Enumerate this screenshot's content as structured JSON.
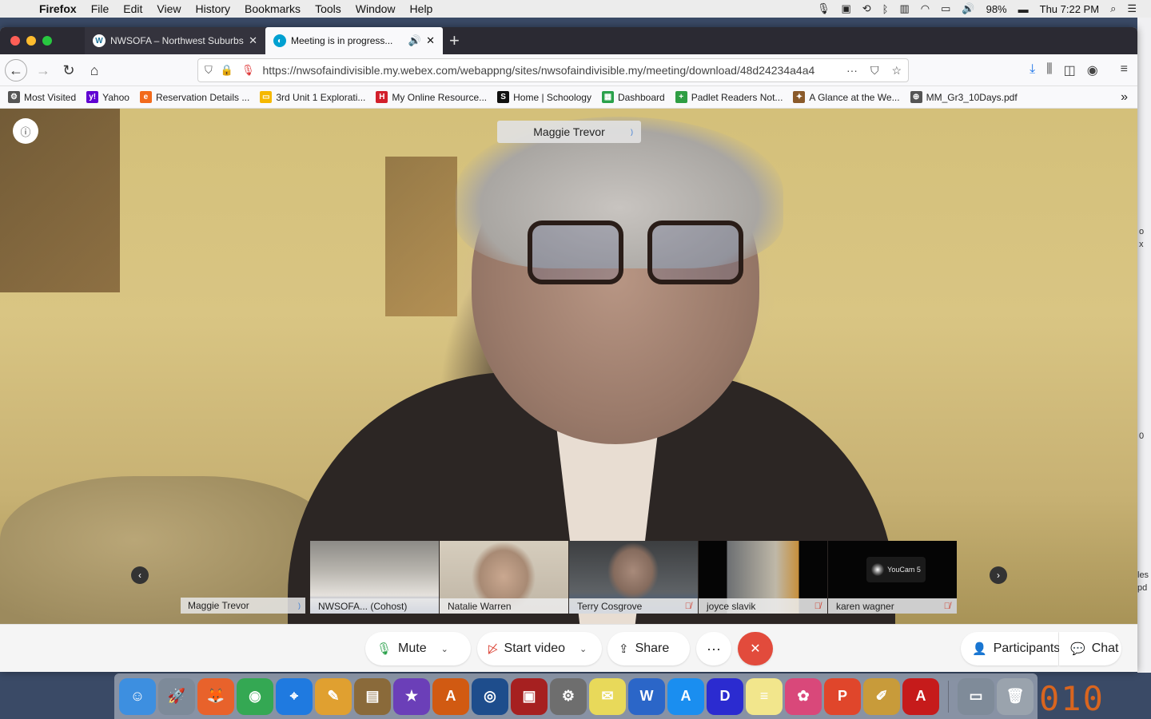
{
  "menubar": {
    "app": "Firefox",
    "items": [
      "File",
      "Edit",
      "View",
      "History",
      "Bookmarks",
      "Tools",
      "Window",
      "Help"
    ],
    "battery": "98%",
    "clock": "Thu 7:22 PM"
  },
  "tabs": [
    {
      "label": "NWSOFA – Northwest Suburbs",
      "icon": "wordpress-icon"
    },
    {
      "label": "Meeting is in progress...",
      "icon": "webex-icon"
    }
  ],
  "address_bar": {
    "url": "https://nwsofaindivisible.my.webex.com/webappng/sites/nwsofaindivisible.my/meeting/download/48d24234a4a4"
  },
  "bookmarks": [
    {
      "label": "Most Visited",
      "color": "#555555",
      "glyph": "⚙"
    },
    {
      "label": "Yahoo",
      "color": "#6001d2",
      "glyph": "y!"
    },
    {
      "label": "Reservation Details ...",
      "color": "#f26a1b",
      "glyph": "e"
    },
    {
      "label": "3rd Unit 1 Explorati...",
      "color": "#f5b800",
      "glyph": "▭"
    },
    {
      "label": "My Online Resource...",
      "color": "#d21f2b",
      "glyph": "H"
    },
    {
      "label": "Home | Schoology",
      "color": "#111111",
      "glyph": "S"
    },
    {
      "label": "Dashboard",
      "color": "#2aa14b",
      "glyph": "▦"
    },
    {
      "label": "Padlet Readers Not...",
      "color": "#2f9e44",
      "glyph": "+"
    },
    {
      "label": "A Glance at the We...",
      "color": "#8a5a2a",
      "glyph": "✦"
    },
    {
      "label": "MM_Gr3_10Days.pdf",
      "color": "#555555",
      "glyph": "⊕"
    }
  ],
  "meeting": {
    "active_speaker": "Maggie Trevor",
    "self_label": "Maggie Trevor",
    "thumbnails": [
      {
        "name": "NWSOFA... (Cohost)",
        "muted": false
      },
      {
        "name": "Natalie Warren",
        "muted": false
      },
      {
        "name": "Terry Cosgrove",
        "muted": true
      },
      {
        "name": "joyce slavik",
        "muted": true
      },
      {
        "name": "karen wagner",
        "muted": true,
        "camera_app": "YouCam 5"
      }
    ]
  },
  "controls": {
    "mute": "Mute",
    "start_video": "Start video",
    "share": "Share",
    "more": "···",
    "end": "✕",
    "participants": "Participants",
    "chat": "Chat"
  },
  "dock": {
    "apps": [
      {
        "name": "Finder",
        "color": "#3d8fe0",
        "glyph": "☺"
      },
      {
        "name": "Launchpad",
        "color": "#7d8a99",
        "glyph": "🚀"
      },
      {
        "name": "Firefox",
        "color": "#e8622b",
        "glyph": "🦊"
      },
      {
        "name": "Chrome",
        "color": "#34a853",
        "glyph": "◉"
      },
      {
        "name": "Safari",
        "color": "#1f7ae0",
        "glyph": "⌖"
      },
      {
        "name": "Stationery Studio",
        "color": "#e0a030",
        "glyph": "✎"
      },
      {
        "name": "Keynote",
        "color": "#8a6a3a",
        "glyph": "▤"
      },
      {
        "name": "iMovie",
        "color": "#6b3fb8",
        "glyph": "★"
      },
      {
        "name": "AverVision",
        "color": "#d15a12",
        "glyph": "A"
      },
      {
        "name": "Photo Booth",
        "color": "#1e4d8c",
        "glyph": "◎"
      },
      {
        "name": "Photo Booth Strip",
        "color": "#a62020",
        "glyph": "▣"
      },
      {
        "name": "System Preferences",
        "color": "#6e6e6e",
        "glyph": "⚙"
      },
      {
        "name": "Stickies",
        "color": "#e8d95a",
        "glyph": "✉"
      },
      {
        "name": "Word",
        "color": "#2b66c8",
        "glyph": "W"
      },
      {
        "name": "App Store",
        "color": "#1a8ef0",
        "glyph": "A"
      },
      {
        "name": "Calendar",
        "color": "#2b2bd0",
        "glyph": "D"
      },
      {
        "name": "Notes",
        "color": "#f2e68c",
        "glyph": "≡"
      },
      {
        "name": "Photos",
        "color": "#d9487a",
        "glyph": "✿"
      },
      {
        "name": "Pages",
        "color": "#e0462b",
        "glyph": "P"
      },
      {
        "name": "TextEdit",
        "color": "#c89b3a",
        "glyph": "✐"
      },
      {
        "name": "Adobe Acrobat",
        "color": "#c61b1b",
        "glyph": "A"
      },
      {
        "name": "Preview",
        "color": "#7f8b99",
        "glyph": "▭"
      },
      {
        "name": "Trash",
        "color": "#9aa3ad",
        "glyph": "🗑"
      }
    ],
    "clock_fragment": "010"
  },
  "right_strip": {
    "fragments": [
      "o",
      "x",
      "0",
      "les",
      "pd"
    ]
  }
}
